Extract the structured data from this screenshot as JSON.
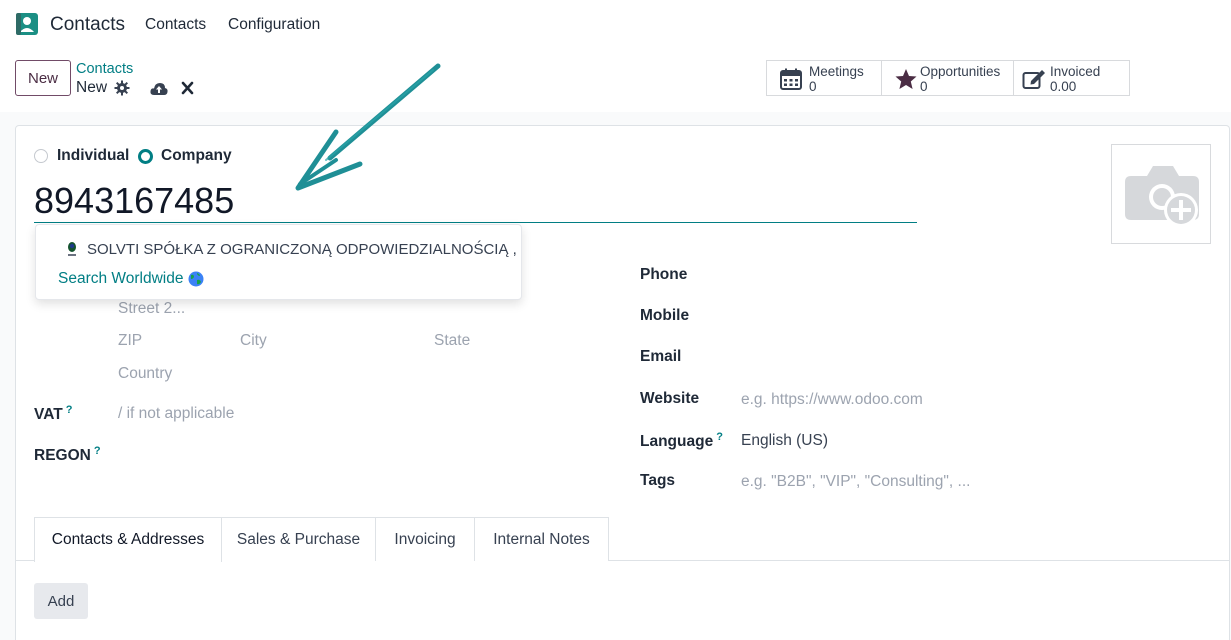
{
  "navbar": {
    "app_name": "Contacts",
    "menu": [
      "Contacts",
      "Configuration"
    ]
  },
  "control": {
    "new_label": "New",
    "breadcrumb_parent": "Contacts",
    "breadcrumb_current": "New",
    "smart_buttons": [
      {
        "label": "Meetings",
        "value": "0",
        "icon": "calendar-icon"
      },
      {
        "label": "Opportunities",
        "value": "0",
        "icon": "star-icon"
      },
      {
        "label": "Invoiced",
        "value": "0.00",
        "icon": "edit-icon"
      }
    ]
  },
  "form": {
    "type_options": [
      "Individual",
      "Company"
    ],
    "type_selected": "Company",
    "name_value": "8943167485",
    "address_placeholders": {
      "street2": "Street 2...",
      "zip": "ZIP",
      "city": "City",
      "state": "State",
      "country": "Country"
    },
    "vat_label": "VAT",
    "vat_placeholder": "/ if not applicable",
    "regon_label": "REGON",
    "help_mark": "?",
    "right_fields": {
      "phone": "Phone",
      "mobile": "Mobile",
      "email": "Email",
      "website": "Website",
      "website_placeholder": "e.g. https://www.odoo.com",
      "language": "Language",
      "language_value": "English (US)",
      "tags": "Tags",
      "tags_placeholder": "e.g. \"B2B\", \"VIP\", \"Consulting\", ..."
    }
  },
  "autocomplete": {
    "company": "SOLVTI SPÓŁKA Z OGRANICZONĄ ODPOWIEDZIALNOŚCIĄ ,",
    "search_worldwide": "Search Worldwide"
  },
  "tabs": [
    "Contacts & Addresses",
    "Sales & Purchase",
    "Invoicing",
    "Internal Notes"
  ],
  "active_tab": "Contacts & Addresses",
  "add_label": "Add",
  "colors": {
    "brand": "#714b67",
    "accent": "#017e84",
    "app_icon": "#1b8f84"
  }
}
